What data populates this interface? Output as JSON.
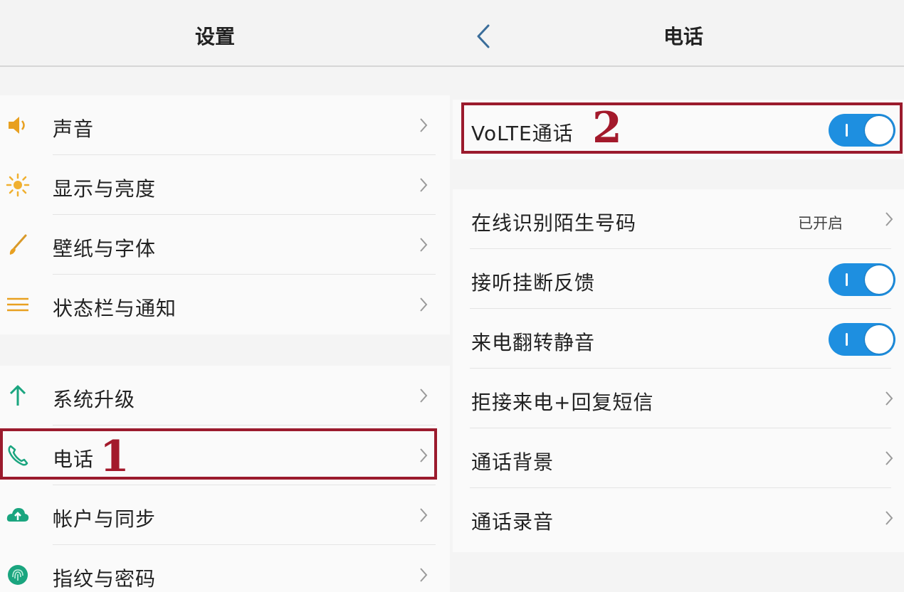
{
  "left_header": {
    "title": "设置"
  },
  "right_header": {
    "title": "电话",
    "back_icon": "chevron-left-icon"
  },
  "settings_list": {
    "items": [
      {
        "label": "声音",
        "icon": "speaker-icon"
      },
      {
        "label": "显示与亮度",
        "icon": "sun-icon"
      },
      {
        "label": "壁纸与字体",
        "icon": "brush-icon"
      },
      {
        "label": "状态栏与通知",
        "icon": "menu-lines-icon"
      },
      {
        "label": "系统升级",
        "icon": "arrow-up-icon"
      },
      {
        "label": "电话",
        "icon": "phone-icon"
      },
      {
        "label": "帐户与同步",
        "icon": "cloud-icon"
      },
      {
        "label": "指纹与密码",
        "icon": "fingerprint-icon"
      }
    ]
  },
  "phone_settings": {
    "volte": {
      "label": "VoLTE通话",
      "enabled": true
    },
    "items": [
      {
        "label": "在线识别陌生号码",
        "value": "已开启"
      },
      {
        "label": "接听挂断反馈",
        "enabled": true
      },
      {
        "label": "来电翻转静音",
        "enabled": true
      },
      {
        "label": "拒接来电+回复短信"
      },
      {
        "label": "通话背景"
      },
      {
        "label": "通话录音"
      }
    ]
  },
  "annotations": {
    "step1": "1",
    "step2": "2",
    "color": "#9b1b2d"
  },
  "colors": {
    "toggle_on": "#1e8fe0",
    "header_bg": "#f3f3f3"
  }
}
